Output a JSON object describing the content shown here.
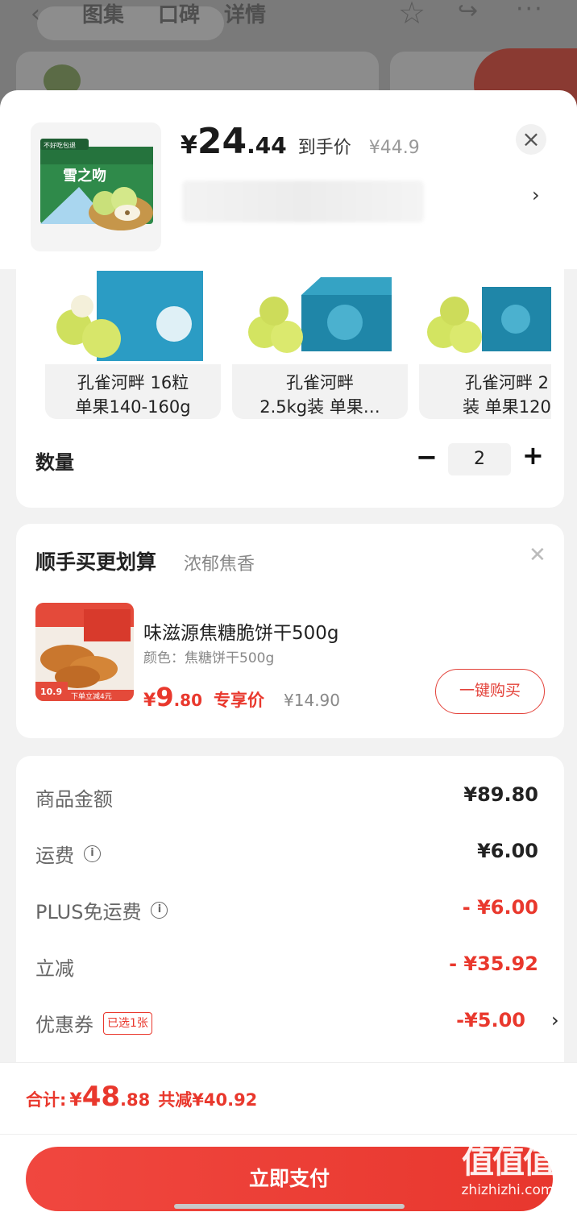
{
  "background": {
    "tabs": [
      "图集",
      "口碑",
      "详情"
    ],
    "pill_text": "不好吃包退"
  },
  "product": {
    "currency": "¥",
    "price_int": "24",
    "price_dec": ".44",
    "price_label": "到手价",
    "original_price": "¥44.9",
    "thumb_banner": "不好吃包退",
    "thumb_brand": "雪之吻"
  },
  "variants": [
    {
      "label": "孔雀河畔 16粒\n单果140-160g"
    },
    {
      "label": "孔雀河畔\n2.5kg装 单果…"
    },
    {
      "label": "孔雀河畔 2\n装 单果120"
    }
  ],
  "quantity": {
    "label": "数量",
    "value": "2",
    "minus": "−",
    "plus": "+"
  },
  "upsell": {
    "title": "顺手买更划算",
    "subtitle": "浓郁焦香",
    "item": {
      "name": "味滋源焦糖脆饼干500g",
      "color": "颜色：焦糖饼干500g",
      "currency": "¥",
      "price_int": "9",
      "price_dec": ".80",
      "price_label": "专享价",
      "original_price": "¥14.90",
      "buy_label": "一键购买",
      "img_tag": "10.9",
      "img_banner": "下单立减4元"
    }
  },
  "summary": [
    {
      "label": "商品金额",
      "value": "¥89.80",
      "info": false,
      "red": false
    },
    {
      "label": "运费",
      "value": "¥6.00",
      "info": true,
      "red": false
    },
    {
      "label": "PLUS免运费",
      "value": "- ¥6.00",
      "info": true,
      "red": true
    },
    {
      "label": "立减",
      "value": "- ¥35.92",
      "info": false,
      "red": true
    },
    {
      "label": "优惠券",
      "value": "-¥5.00",
      "tag": "已选1张",
      "red": true
    }
  ],
  "footer": {
    "total_label": "合计:",
    "currency": "¥",
    "total_int": "48",
    "total_dec": ".88",
    "saved": "共减¥40.92",
    "pay_label": "立即支付"
  },
  "watermark": {
    "line1": "值值值",
    "line2": "zhizhizhi.com"
  },
  "colors": {
    "accent": "#e9382d",
    "pay_button": "#ee4037"
  }
}
